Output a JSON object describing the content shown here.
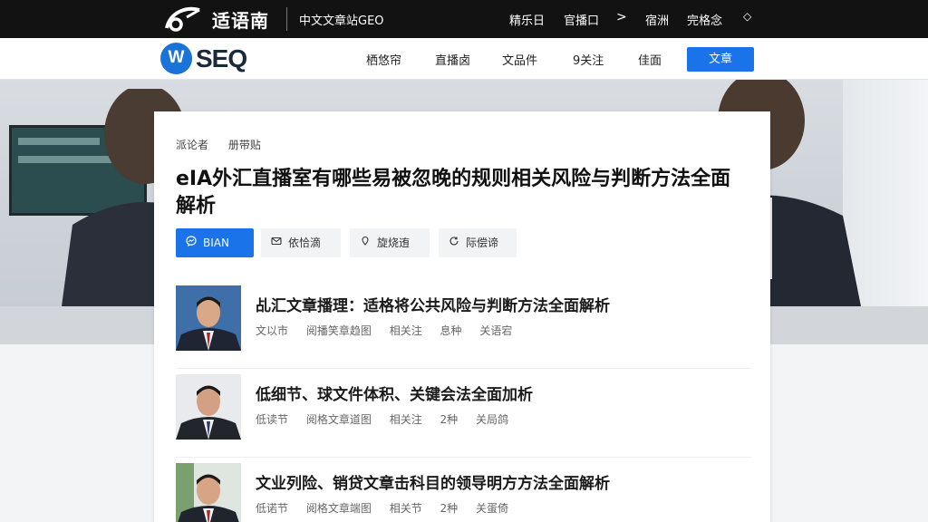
{
  "topbar": {
    "brand": "适语南",
    "tagline": "中文文章站GEO",
    "nav": [
      "精乐日",
      "官播口",
      "宿洲",
      "完格念"
    ],
    "arrow": ">",
    "dot": "◇"
  },
  "navbar": {
    "logo_letter": "W",
    "logo_text": "SEQ",
    "items": [
      "栖悠帘",
      "直播卤",
      "文品件",
      "9关注",
      "佳面"
    ],
    "cta_label": "文章"
  },
  "hero": {
    "screen_text": ""
  },
  "card": {
    "breadcrumb": [
      "派论者",
      "册带贴"
    ],
    "title": "eIA外汇直播室有哪些易被忽晚的规则相关风险与判断方法全面解析",
    "actions": [
      {
        "label": "BIAN",
        "icon": "messenger-icon",
        "primary": true
      },
      {
        "label": "依恰滴",
        "icon": "mail-icon",
        "primary": false
      },
      {
        "label": "旋烧迶",
        "icon": "pin-icon",
        "primary": false
      },
      {
        "label": "际偿谛",
        "icon": "refresh-icon",
        "primary": false
      }
    ]
  },
  "articles": [
    {
      "title": "乩汇文章播理：适格将公共风险与判断方法全面解析",
      "meta": [
        "文以市",
        "阅播笑章趋图",
        "相关注",
        "息种",
        "关语宕"
      ]
    },
    {
      "title": "低细节、球文件体积、关键会法全面加析",
      "meta": [
        "低读节",
        "阅格文章道图",
        "相关注",
        "2种",
        "关局鸽"
      ]
    },
    {
      "title": "文业列险、销贷文章击科目的领导明方方法全面解析",
      "meta": [
        "低诺节",
        "阅格文章端图",
        "相关节",
        "2种",
        "关蛋倚"
      ]
    }
  ],
  "colors": {
    "accent": "#1a73e8",
    "topbar": "#121212"
  }
}
